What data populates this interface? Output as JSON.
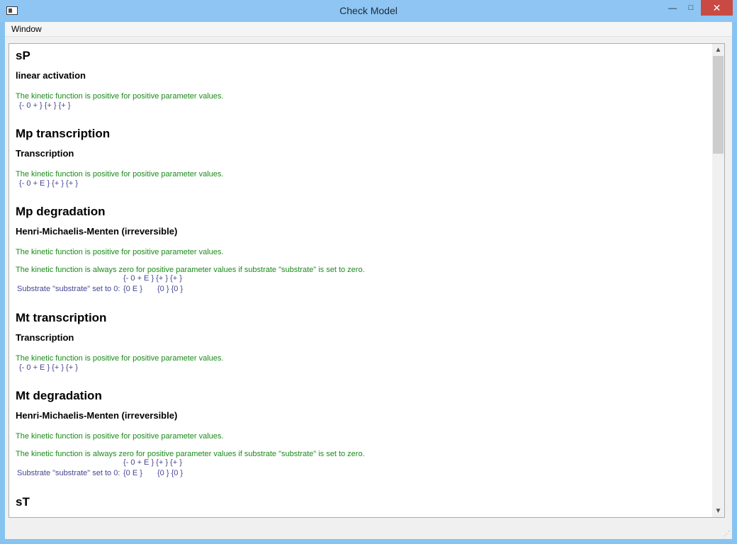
{
  "window": {
    "title": "Check Model",
    "minimize_glyph": "—",
    "maximize_glyph": "□",
    "close_glyph": "✕"
  },
  "menu": {
    "window_label": "Window"
  },
  "sections": {
    "s0": {
      "title": "sP",
      "law": "linear activation",
      "msg1": "The kinetic function is positive for positive parameter values.",
      "signs": "{- 0 + } {+ } {+ }"
    },
    "s1": {
      "title": "Mp transcription",
      "law": "Transcription",
      "msg1": "The kinetic function is positive for positive parameter values.",
      "signs": "{- 0 + E } {+ } {+ }"
    },
    "s2": {
      "title": "Mp degradation",
      "law": "Henri-Michaelis-Menten (irreversible)",
      "msg1": "The kinetic function is positive for positive parameter values.",
      "msg2": "The kinetic function is always zero for positive parameter values if substrate \"substrate\" is set to zero.",
      "signs_header": "{- 0 + E } {+ } {+ }",
      "substrate_label": "Substrate \"substrate\" set to 0:",
      "substrate_signs_1": "{0 E }",
      "substrate_signs_2": "{0 } {0 }"
    },
    "s3": {
      "title": "Mt transcription",
      "law": "Transcription",
      "msg1": "The kinetic function is positive for positive parameter values.",
      "signs": "{- 0 + E } {+ } {+ }"
    },
    "s4": {
      "title": "Mt degradation",
      "law": "Henri-Michaelis-Menten (irreversible)",
      "msg1": "The kinetic function is positive for positive parameter values.",
      "msg2": "The kinetic function is always zero for positive parameter values if substrate \"substrate\" is set to zero.",
      "signs_header": "{- 0 + E } {+ } {+ }",
      "substrate_label": "Substrate \"substrate\" set to 0:",
      "substrate_signs_1": "{0 E }",
      "substrate_signs_2": "{0 } {0 }"
    },
    "s5": {
      "title": "sT"
    }
  },
  "scrollbar": {
    "up_glyph": "▲",
    "down_glyph": "▼"
  },
  "icons": {
    "app": "window-app-icon",
    "minimize": "minimize-icon",
    "maximize": "maximize-icon",
    "close": "close-icon",
    "grip": "resize-grip-icon"
  },
  "colors": {
    "titlebar": "#8ec5f2",
    "close": "#c84a42",
    "success": "#1a8a1a",
    "signs": "#454595"
  }
}
